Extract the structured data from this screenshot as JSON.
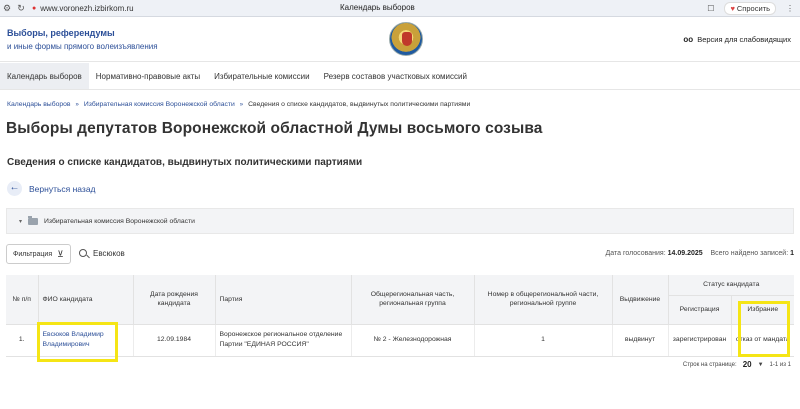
{
  "browser": {
    "url": "www.voronezh.izbirkom.ru",
    "tab_title": "Календарь выборов",
    "ask_button": "Спросить"
  },
  "header": {
    "brand_line1": "Выборы, референдумы",
    "brand_line2": "и иные формы прямого волеизъявления",
    "accessibility": "Версия для слабовидящих"
  },
  "topnav": [
    "Календарь выборов",
    "Нормативно-правовые акты",
    "Избирательные комиссии",
    "Резерв составов участковых комиссий"
  ],
  "breadcrumb": [
    "Календарь выборов",
    "Избирательная комиссия Воронежской области",
    "Сведения о списке кандидатов, выдвинутых политическими партиями"
  ],
  "page_title": "Выборы депутатов Воронежской областной Думы восьмого созыва",
  "section_title": "Сведения о списке кандидатов, выдвинутых политическими партиями",
  "back_label": "Вернуться назад",
  "tree_node": "Избирательная комиссия Воронежской области",
  "filter": {
    "button_label": "Фильтрация",
    "search_value": "Евсюков",
    "vote_date_label": "Дата голосования:",
    "vote_date": "14.09.2025",
    "found_label": "Всего найдено записей:",
    "found_count": "1"
  },
  "table": {
    "headers": {
      "num": "№ п/п",
      "fio": "ФИО кандидата",
      "birth": "Дата рождения кандидата",
      "party": "Партия",
      "regional": "Общерегиональная часть, региональная группа",
      "number": "Номер в общерегиональной части, региональной группе",
      "nomination": "Выдвижение",
      "status": "Статус кандидата",
      "registration": "Регистрация",
      "election": "Избрание"
    },
    "rows": [
      {
        "num": "1.",
        "fio": "Евсюков Владимир Владимирович",
        "birth": "12.09.1984",
        "party": "Воронежское региональное отделение Партии \"ЕДИНАЯ РОССИЯ\"",
        "regional": "№ 2 - Железнодорожная",
        "number": "1",
        "nomination": "выдвинут",
        "registration": "зарегистрирован",
        "election": "отказ от мандата"
      }
    ]
  },
  "pager": {
    "per_page_label": "Строк на странице:",
    "per_page": "20",
    "range": "1-1 из 1"
  },
  "colors": {
    "link": "#2c4f98",
    "highlight": "#f5e515"
  }
}
